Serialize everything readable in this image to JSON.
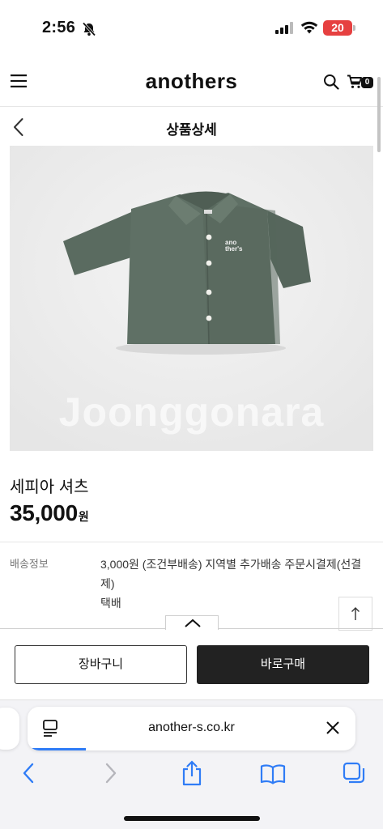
{
  "status_bar": {
    "time": "2:56",
    "battery": "20",
    "icons": [
      "silent-bell-icon",
      "signal-icon",
      "wifi-icon",
      "battery-icon"
    ]
  },
  "header": {
    "logo": "anothers",
    "cart_count": "0",
    "icons": [
      "menu-icon",
      "search-icon",
      "cart-icon"
    ]
  },
  "subheader": {
    "title": "상품상세",
    "icon": "back-chevron-icon"
  },
  "product": {
    "watermark": "Joonggonara",
    "shirt_print": "ano ther's",
    "name": "세피아 셔츠",
    "price": "35,000",
    "price_unit": "원"
  },
  "shipping": {
    "label": "배송정보",
    "info": "3,000원 (조건부배송) 지역별 추가배송 주문시결제(선결제)",
    "method": "택배"
  },
  "actions": {
    "cart_label": "장바구니",
    "buy_label": "바로구매"
  },
  "browser": {
    "url": "another-s.co.kr",
    "icons": [
      "reader-icon",
      "close-icon",
      "back-icon",
      "forward-icon",
      "share-icon",
      "bookmarks-icon",
      "tabs-icon"
    ]
  },
  "colors": {
    "accent": "#2f7cf6",
    "buy_button": "#222222",
    "battery": "#e64040",
    "shirt": "#5c6d62"
  }
}
